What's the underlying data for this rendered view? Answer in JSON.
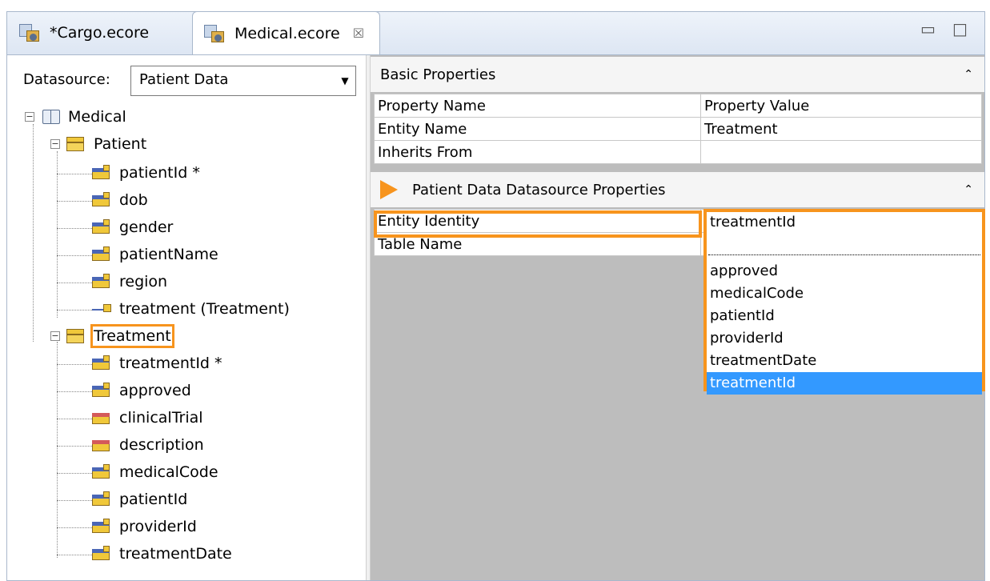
{
  "tabs": [
    {
      "label": "*Cargo.ecore"
    },
    {
      "label": "Medical.ecore",
      "close": "☒"
    }
  ],
  "window_controls": {
    "minimize": "▭",
    "maximize": "□"
  },
  "datasource": {
    "label": "Datasource:",
    "value": "Patient Data",
    "arrow": "▼"
  },
  "tree": {
    "root": "Medical",
    "patient": {
      "label": "Patient",
      "children": [
        "patientId *",
        "dob",
        "gender",
        "patientName",
        "region",
        "treatment (Treatment)"
      ]
    },
    "treatment": {
      "label": "Treatment",
      "children": [
        "treatmentId *",
        "approved",
        "clinicalTrial",
        "description",
        "medicalCode",
        "patientId",
        "providerId",
        "treatmentDate"
      ]
    },
    "toggle_collapsed": "−"
  },
  "basic_properties": {
    "title": "Basic Properties",
    "collapse": "⌃",
    "headers": [
      "Property Name",
      "Property Value"
    ],
    "rows": [
      {
        "name": "Entity Name",
        "value": "Treatment"
      },
      {
        "name": "Inherits From",
        "value": ""
      }
    ]
  },
  "datasource_properties": {
    "title": "Patient Data Datasource Properties",
    "collapse": "⌃",
    "rows": [
      {
        "name": "Entity Identity"
      },
      {
        "name": "Table Name"
      }
    ]
  },
  "dropdown": {
    "value": "treatmentId",
    "options": [
      "approved",
      "medicalCode",
      "patientId",
      "providerId",
      "treatmentDate",
      "treatmentId"
    ],
    "selected": "treatmentId"
  },
  "colors": {
    "highlight": "#f7941d",
    "selection": "#3399ff"
  }
}
